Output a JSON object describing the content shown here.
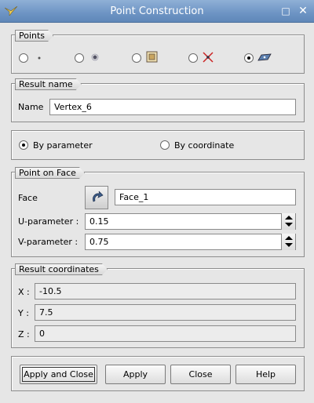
{
  "window": {
    "title": "Point Construction",
    "maximize_glyph": "□",
    "close_glyph": "✕"
  },
  "points_group": {
    "title": "Points",
    "options": [
      {
        "icon": "point-by-coordinates-icon",
        "checked": false
      },
      {
        "icon": "point-reference-icon",
        "checked": false
      },
      {
        "icon": "point-on-edge-icon",
        "checked": false
      },
      {
        "icon": "point-intersection-icon",
        "checked": false
      },
      {
        "icon": "point-on-face-icon",
        "checked": true
      }
    ]
  },
  "result_name": {
    "title": "Result name",
    "label": "Name",
    "value": "Vertex_6"
  },
  "mode": {
    "by_parameter": "By parameter",
    "by_coordinate": "By coordinate",
    "selected": "by_parameter"
  },
  "point_on_face": {
    "title": "Point on Face",
    "face_label": "Face",
    "face_value": "Face_1",
    "u_label": "U-parameter :",
    "u_value": "0.15",
    "v_label": "V-parameter :",
    "v_value": "0.75"
  },
  "result_coordinates": {
    "title": "Result coordinates",
    "x_label": "X :",
    "x_value": "-10.5",
    "y_label": "Y :",
    "y_value": "7.5",
    "z_label": "Z :",
    "z_value": "0"
  },
  "buttons": {
    "apply_and_close": "Apply and Close",
    "apply": "Apply",
    "close": "Close",
    "help": "Help"
  },
  "colors": {
    "titlebar": "#6d94c4",
    "dialog_background": "#e6e6e6"
  }
}
